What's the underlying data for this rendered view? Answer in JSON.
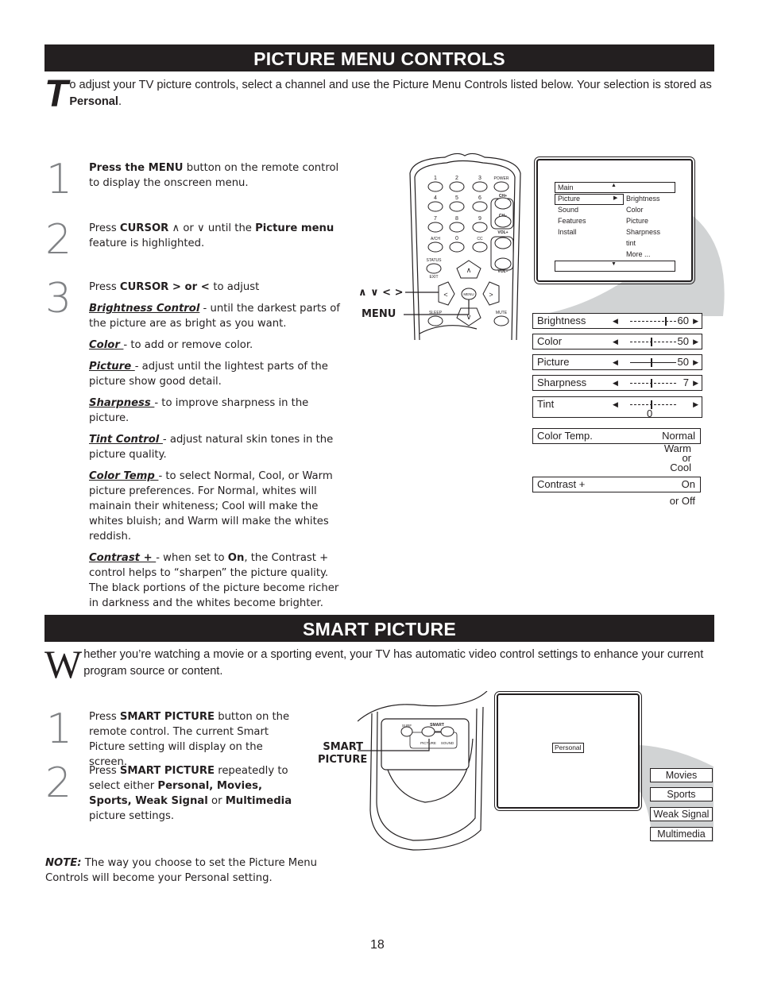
{
  "section1": {
    "title": "PICTURE MENU CONTROLS",
    "intro_dropcap": "T",
    "intro_text": "o adjust your TV picture controls, select a channel and use the Picture Menu Controls listed below. Your selection is stored as ",
    "intro_bold": "Personal",
    "intro_end": ".",
    "steps": [
      {
        "number": "1",
        "bold": "Press the MENU",
        "text": " button on the remote control to display the onscreen menu."
      },
      {
        "number": "2",
        "pre": "Press ",
        "bold": "CURSOR",
        "mid": "  ∧  or ∨ until the ",
        "bold2": "Picture menu",
        "text": " feature is highlighted."
      },
      {
        "number": "3",
        "pre": "Press ",
        "bold": "CURSOR",
        "mid": "  >  or  < ",
        "text": "to adjust"
      }
    ],
    "controls": [
      {
        "term": "Brightness Control",
        "desc": " - until the darkest parts of the picture are as bright as you want."
      },
      {
        "term": "Color ",
        "desc": " -  to add or remove color."
      },
      {
        "term": "Picture ",
        "desc": " -  adjust until the lightest parts of the picture show good detail."
      },
      {
        "term": "Sharpness ",
        "desc": "-  to improve sharpness in the picture."
      },
      {
        "term": "Tint Control ",
        "desc": "- adjust natural skin tones in the picture quality."
      },
      {
        "term": "Color Temp ",
        "desc": " -  to select Normal, Cool, or Warm picture preferences.  For Normal, whites will mainain their whiteness; Cool will make the whites bluish; and Warm will make the whites reddish."
      },
      {
        "term": "Contrast + ",
        "desc_pre": " -   when set to ",
        "desc_bold": "On",
        "desc": ", the Contrast + control helps to “sharpen” the picture quality. The black portions of the picture become richer in darkness and the whites become brighter."
      }
    ],
    "remote": {
      "buttons": [
        "1",
        "2",
        "3",
        "POWER",
        "4",
        "5",
        "6",
        "CH+",
        "7",
        "8",
        "9",
        "CH-",
        "A/CH",
        "0",
        "CC",
        "VOL+",
        "STATUS",
        "EXIT",
        "MENU",
        "SLEEP",
        "MUTE",
        "VOL-"
      ],
      "callout_cursor": "∧ ∨ < >",
      "callout_menu": "MENU"
    },
    "tv_menu": {
      "main_label": "Main",
      "left_items": [
        "Picture",
        "Sound",
        "Features",
        "Install"
      ],
      "right_items": [
        "Brightness",
        "Color",
        "Picture",
        "Sharpness",
        "tint",
        "More ..."
      ]
    },
    "sliders": [
      {
        "label": "Brightness",
        "value": "60",
        "position": 0.75
      },
      {
        "label": "Color",
        "value": "50",
        "position": 0.45
      },
      {
        "label": "Picture",
        "value": "50",
        "position": 0.45
      },
      {
        "label": "Sharpness",
        "value": "7",
        "position": 0.45
      },
      {
        "label": "Tint",
        "value": "0",
        "position": 0.45
      }
    ],
    "color_temp": {
      "label": "Color Temp.",
      "value": "Normal",
      "alt": [
        "Warm",
        "or",
        "Cool"
      ]
    },
    "contrast_plus": {
      "label": "Contrast +",
      "value": "On",
      "alt": "or Off"
    }
  },
  "section2": {
    "title": "SMART PICTURE",
    "intro_dropcap": "W",
    "intro_text": "hether you’re watching a movie or a sporting event, your TV has automatic video control settings to enhance your current program source or content.",
    "steps": [
      {
        "number": "1",
        "pre": "Press ",
        "bold": "SMART PICTURE",
        "text": " button on the remote control. The current Smart Picture setting will display on the screen."
      },
      {
        "number": "2",
        "pre": "Press ",
        "bold": "SMART PICTURE",
        "mid": " repeatedly to select either ",
        "bold2": "Personal, Movies, Sports, Weak Signal",
        "mid2": " or ",
        "bold3": "Multimedia",
        "text": " picture settings."
      }
    ],
    "remote": {
      "surf": "SURF",
      "smart": "SMART",
      "picture": "PICTURE",
      "sound": "SOUND",
      "callout": [
        "SMART",
        "PICTURE"
      ]
    },
    "current_setting": "Personal",
    "options": [
      "Movies",
      "Sports",
      "Weak Signal",
      "Multimedia"
    ]
  },
  "note": {
    "label": "NOTE:",
    "text": " The way you choose to set the Picture Menu Controls will become your Personal setting."
  },
  "page_number": "18"
}
